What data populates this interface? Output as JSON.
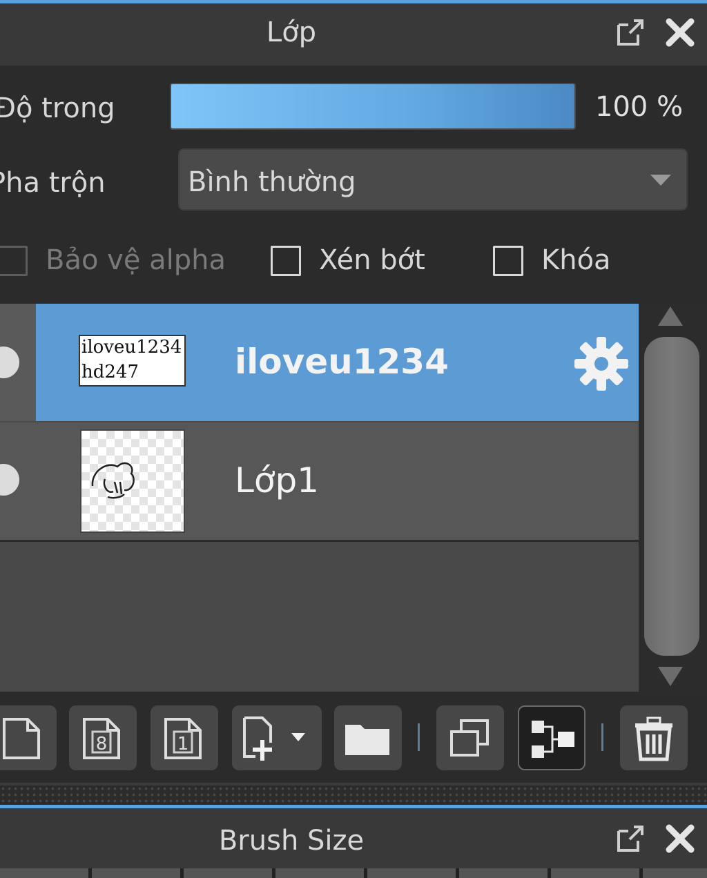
{
  "panel": {
    "title": "Lớp",
    "opacity_label": "Độ trong",
    "opacity_value": 1.0,
    "opacity_text": "100 %",
    "blend_label": "Pha trộn",
    "blend_value": "Bình thường",
    "protect_alpha": "Bảo vệ alpha",
    "clip": "Xén bớt",
    "lock": "Khóa"
  },
  "layers": [
    {
      "name": "iloveu1234",
      "thumb_text_1": "iloveu1234",
      "thumb_text_2": "hd247",
      "selected": true
    },
    {
      "name": "Lớp1",
      "selected": false
    }
  ],
  "toolbar": {
    "buttons": [
      "new-layer",
      "new-layer-8bit",
      "new-layer-1bit",
      "new-layer-dropdown",
      "new-folder",
      "duplicate-layer",
      "merge-down",
      "delete-layer"
    ]
  },
  "bottom_panel": {
    "title": "Brush Size"
  },
  "colors": {
    "accent": "#5c9bd3",
    "background": "#2b2b2b"
  }
}
